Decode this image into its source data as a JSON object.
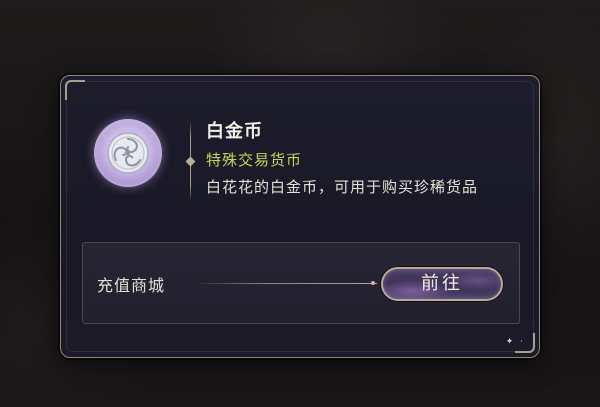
{
  "item": {
    "name": "白金币",
    "type": "特殊交易货币",
    "description": "白花花的白金币，可用于购买珍稀货品",
    "icon": "platinum-coin-icon"
  },
  "source": {
    "label": "充值商城",
    "button_label": "前往"
  },
  "colors": {
    "type_text": "#c4d65a",
    "panel_border": "#8d8678",
    "panel_bg": "#1b1a28"
  }
}
